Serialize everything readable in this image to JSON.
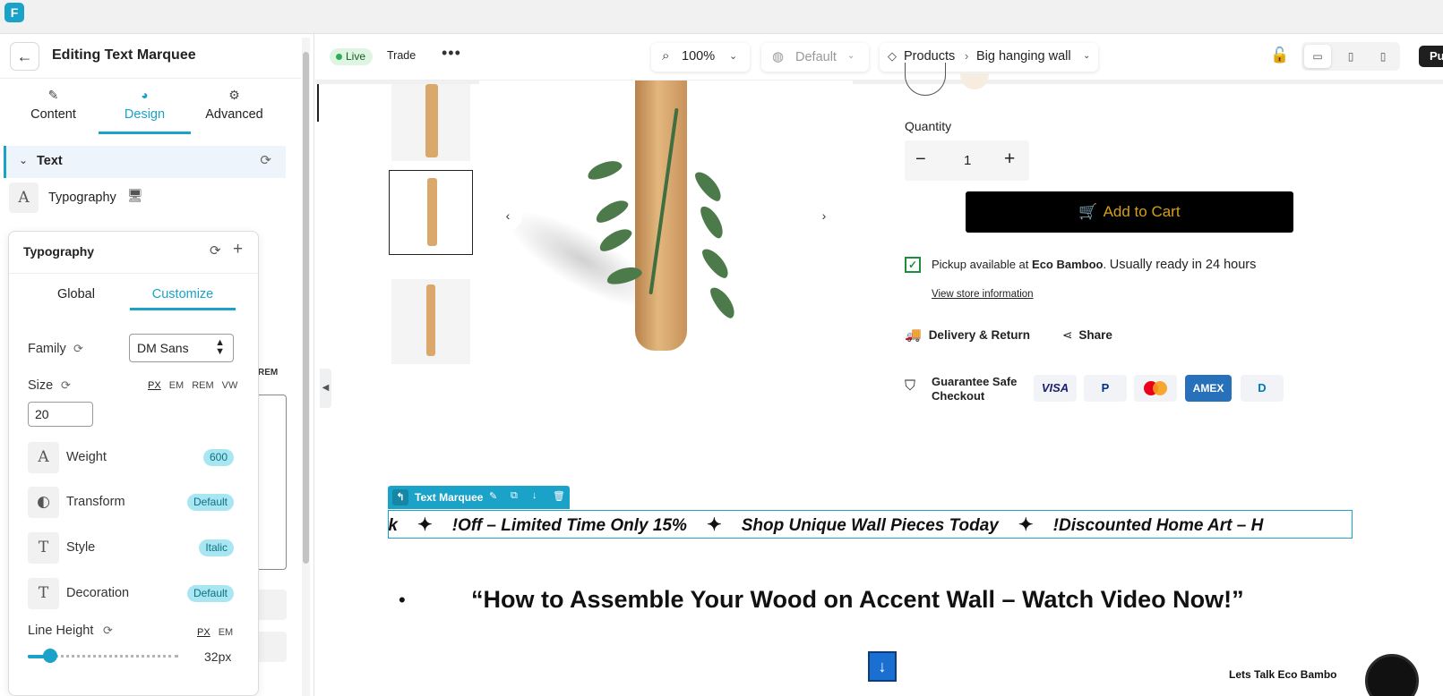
{
  "app": {
    "logo_icon": "app-logo-icon"
  },
  "panel": {
    "title": "Editing Text Marquee",
    "tabs": [
      {
        "label": "Content",
        "icon": "pencil-icon"
      },
      {
        "label": "Design",
        "icon": "palette-icon",
        "active": true
      },
      {
        "label": "Advanced",
        "icon": "gear-icon"
      }
    ],
    "section": {
      "label": "Text"
    },
    "typography_row": {
      "label": "Typography"
    },
    "behind_unit": "REM"
  },
  "typography_popup": {
    "title": "Typography",
    "tabs": [
      "Global",
      "Customize"
    ],
    "active_tab": "Customize",
    "family": {
      "label": "Family",
      "value": "DM Sans"
    },
    "size": {
      "label": "Size",
      "units": [
        "PX",
        "EM",
        "REM",
        "VW"
      ],
      "selected_unit": "PX",
      "value": "20"
    },
    "weight": {
      "label": "Weight",
      "value": "600"
    },
    "transform": {
      "label": "Transform",
      "value": "Default"
    },
    "style": {
      "label": "Style",
      "value": "Italic"
    },
    "decoration": {
      "label": "Decoration",
      "value": "Default"
    },
    "line_height": {
      "label": "Line Height",
      "units": [
        "PX",
        "EM"
      ],
      "selected_unit": "PX",
      "value": "32px",
      "slider_fraction": 0.1
    }
  },
  "toolbar": {
    "status": "Live",
    "store": "Trade",
    "zoom": "100%",
    "language": "Default",
    "breadcrumb": [
      "Products",
      "Big hanging wall"
    ],
    "publish": "Pub"
  },
  "product": {
    "quantity_label": "Quantity",
    "quantity_value": "1",
    "add_to_cart": "Add to Cart",
    "pickup_prefix": "Pickup available at",
    "pickup_store": "Eco Bamboo",
    "pickup_ready": "Usually ready in 24 hours",
    "store_link": "View store information",
    "delivery": "Delivery & Return",
    "share": "Share",
    "guarantee": "Guarantee Safe Checkout",
    "payments": [
      {
        "name": "VISA",
        "color": "#1a1f71"
      },
      {
        "name": "P",
        "color": "#003087"
      },
      {
        "name": "mastercard",
        "color": "#eb001b"
      },
      {
        "name": "AMEX",
        "color": "#ffffff"
      },
      {
        "name": "D",
        "color": "#0079be"
      }
    ]
  },
  "widget": {
    "tag_label": "Text Marquee"
  },
  "marquee": {
    "items": [
      "rk",
      "!Off – Limited Time Only 15%",
      "Shop Unique Wall Pieces Today",
      "!Discounted Home Art – H"
    ]
  },
  "heading": "“How to Assemble Your Wood on Accent Wall – Watch Video Now!”",
  "chat_text": "Lets  Talk Eco Bambo",
  "colors": {
    "accent": "#1aa2c8",
    "cart_text": "#d4a017",
    "live": "#2fae4f"
  }
}
